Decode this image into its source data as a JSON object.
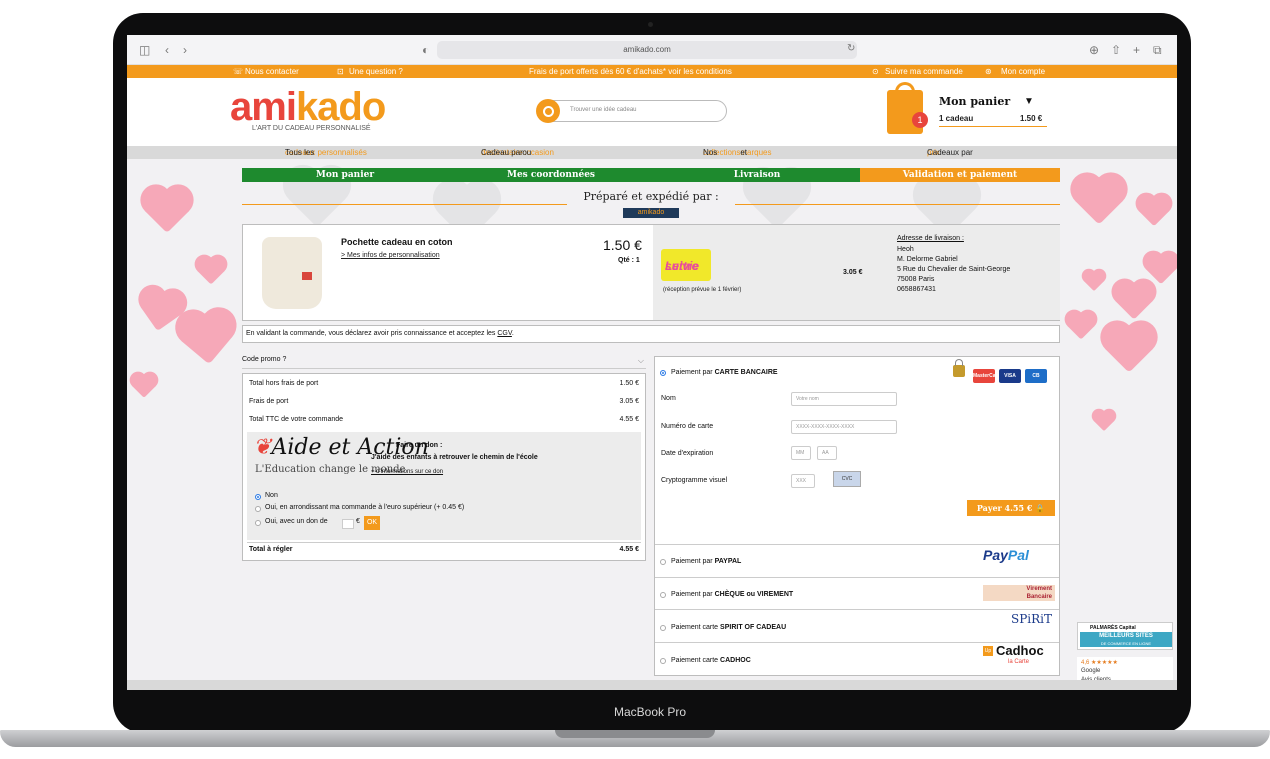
{
  "device": {
    "label": "MacBook Pro"
  },
  "browser": {
    "url": "amikado.com",
    "icons": [
      "sidebar-icon",
      "back-icon",
      "forward-icon",
      "privacy-icon",
      "reload-icon",
      "download-icon",
      "share-icon",
      "new-tab-icon",
      "tabs-icon"
    ]
  },
  "topstrip": {
    "contact": "Nous contacter",
    "question": "Une question ?",
    "promo": "Frais de port offerts dès 60 € d'achats* voir les conditions",
    "track": "Suivre ma commande",
    "account": "Mon compte"
  },
  "header": {
    "logo_a": "ami",
    "logo_b": "kado",
    "tagline": "L'ART DU CADEAU PERSONNALISÉ",
    "search_placeholder": "Trouver une idée cadeau",
    "cart_count": "1",
    "cart_title": "Mon panier",
    "cart_items": "1 cadeau",
    "cart_total": "1.50 €"
  },
  "catnav": {
    "c1_a": "Tous les ",
    "c1_b": "cadeaux personnalisés",
    "c2_a": "Cadeau par ",
    "c2_b": "destinataire",
    "c2_c": " ou ",
    "c2_d": "occasion",
    "c3_a": "Nos ",
    "c3_b": "collections",
    "c3_c": " et ",
    "c3_d": "marques",
    "c4_a": "Cadeaux par ",
    "c4_b": "prix"
  },
  "steps": [
    "Mon panier",
    "Mes coordonnées",
    "Livraison",
    "Validation et paiement"
  ],
  "prep": {
    "title": "Préparé et expédié par :",
    "badge": "amikado"
  },
  "order": {
    "product_name": "Pochette cadeau en coton",
    "product_link": "> Mes infos de personnalisation",
    "price": "1.50 €",
    "qty": "Qté : 1",
    "carrier_small": "Lettre",
    "carrier": "suivie",
    "reception": "(réception prévue le 1 février)",
    "shipping_price": "3.05 €",
    "address_title": "Adresse de livraison :",
    "address": [
      "Heoh",
      "M. Delorme Gabriel",
      "5 Rue du Chevalier de Saint-George",
      "75008 Paris",
      "0658867431"
    ]
  },
  "cgv": {
    "text": "En validant la commande, vous déclarez avoir pris connaissance et acceptez les ",
    "link": "CGV",
    "end": "."
  },
  "summary": {
    "promo": "Code promo ?",
    "rows": [
      {
        "label": "Total hors frais de port",
        "value": "1.50 €"
      },
      {
        "label": "Frais de port",
        "value": "3.05 €"
      },
      {
        "label": "Total TTC de votre commande",
        "value": "4.55 €"
      }
    ],
    "aide_logo": "Aide et Action",
    "aide_sub": "L'Education change le monde",
    "don_title": "Faire un don :",
    "don_line": "J'aide des enfants à retrouver le chemin de l'école",
    "don_info": "+ d'informations sur ce don",
    "opt_no": "Non",
    "opt_round": "Oui, en arrondissant ma commande à l'euro supérieur (+ 0.45 €)",
    "opt_custom": "Oui, avec un don de",
    "currency": "€",
    "ok": "OK",
    "total_label": "Total à régler",
    "total_value": "4.55 €"
  },
  "payment": {
    "card_prefix": "Paiement par ",
    "card_bold": "CARTE BANCAIRE",
    "cards": [
      "MasterCard",
      "VISA",
      "CB"
    ],
    "name_label": "Nom",
    "name_placeholder": "Votre nom",
    "number_label": "Numéro de carte",
    "number_placeholder": "XXXX-XXXX-XXXX-XXXX",
    "expiry_label": "Date d'expiration",
    "mm": "MM",
    "aa": "AA",
    "cvc_label": "Cryptogramme visuel",
    "cvc_placeholder": "XXX",
    "cvc_hint": "CVC",
    "pay_button": "Payer 4.55 €",
    "paypal_prefix": "Paiement par ",
    "paypal_bold": "PAYPAL",
    "paypal_a": "Pay",
    "paypal_b": "Pal",
    "cheque_prefix": "Paiement par ",
    "cheque_bold": "CHÈQUE ou VIREMENT",
    "virement_a": "Virement",
    "virement_b": "Bancaire",
    "spirit_prefix": "Paiement carte ",
    "spirit_bold": "SPIRIT OF CADEAU",
    "spirit_logo": "SPiRiT",
    "cadhoc_prefix": "Paiement carte ",
    "cadhoc_bold": "CADHOC",
    "cadhoc_logo": "Cadhoc",
    "cadhoc_sub": "la Carte",
    "up": "Up"
  },
  "badges": {
    "palmares_1": "PALMARÈS Capital",
    "palmares_2": "MEILLEURS SITES",
    "palmares_3": "DE COMMERCE EN LIGNE",
    "rating": "4,6 ★★★★★",
    "google": "Google",
    "avis": "Avis clients"
  },
  "colors": {
    "orange": "#f39a1c",
    "green": "#1e8a2e",
    "red": "#e8453c",
    "pink": "#f6a8b8"
  }
}
